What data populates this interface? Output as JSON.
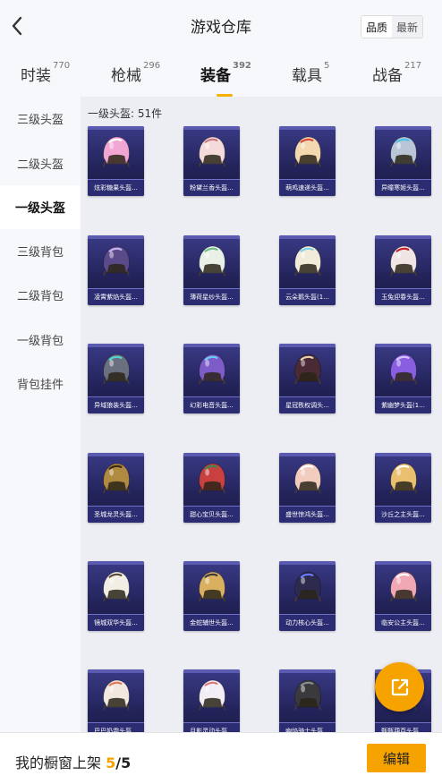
{
  "header": {
    "title": "游戏仓库",
    "sort_options": [
      "品质",
      "最新"
    ],
    "sort_selected": "品质"
  },
  "tabs": [
    {
      "label": "时装",
      "count": "770"
    },
    {
      "label": "枪械",
      "count": "296"
    },
    {
      "label": "装备",
      "count": "392"
    },
    {
      "label": "载具",
      "count": "5"
    },
    {
      "label": "战备",
      "count": "217"
    }
  ],
  "active_tab": "装备",
  "sidebar": {
    "items": [
      {
        "label": "三级头盔"
      },
      {
        "label": "二级头盔"
      },
      {
        "label": "一级头盔"
      },
      {
        "label": "三级背包"
      },
      {
        "label": "二级背包"
      },
      {
        "label": "一级背包"
      },
      {
        "label": "背包挂件"
      }
    ],
    "active": "一级头盔"
  },
  "main": {
    "count_label": "一级头盔: 51件",
    "items": [
      {
        "name": "炫彩糖果头盔...",
        "color": "#f2a6d4",
        "accent": "#ffffff"
      },
      {
        "name": "粉黛兰香头盔...",
        "color": "#f4dada",
        "accent": "#c97a84"
      },
      {
        "name": "萌鸡速递头盔...",
        "color": "#f3d8b0",
        "accent": "#d84a3a"
      },
      {
        "name": "异瞳寒姬头盔...",
        "color": "#b8c6d8",
        "accent": "#4ac3e8"
      },
      {
        "name": "凌霄紫焰头盔...",
        "color": "#5b4a8a",
        "accent": "#c6b2f0"
      },
      {
        "name": "薄荷星纱头盔...",
        "color": "#e8f0e8",
        "accent": "#6fbf8a"
      },
      {
        "name": "云朵鹅头盔(1...",
        "color": "#f1ecd9",
        "accent": "#7fd0e6"
      },
      {
        "name": "玉兔迎春头盔...",
        "color": "#f1e4e4",
        "accent": "#c8202a"
      },
      {
        "name": "异域狼装头盔...",
        "color": "#6b7080",
        "accent": "#4fd6d0"
      },
      {
        "name": "幻彩电音头盔...",
        "color": "#7e5cc8",
        "accent": "#63d2f0"
      },
      {
        "name": "星冠秩权调头...",
        "color": "#4a2a34",
        "accent": "#e8d2b4"
      },
      {
        "name": "紫幽梦头盔(1...",
        "color": "#8a5ee0",
        "accent": "#d6c6ff"
      },
      {
        "name": "圣城龙灵头盔...",
        "color": "#b08a40",
        "accent": "#3a2a10"
      },
      {
        "name": "甜心宝贝头盔...",
        "color": "#c84040",
        "accent": "#3a8a4a"
      },
      {
        "name": "盛世惊鸿头盔...",
        "color": "#f2cdbf",
        "accent": "#ffffff"
      },
      {
        "name": "沙丘之主头盔...",
        "color": "#e8c070",
        "accent": "#ffffff"
      },
      {
        "name": "镜城双华头盔...",
        "color": "#f2eee6",
        "accent": "#5a4a3a"
      },
      {
        "name": "金蛇辅世头盔...",
        "color": "#d8b060",
        "accent": "#3a3a3a"
      },
      {
        "name": "动力核心头盔...",
        "color": "#2e2a4e",
        "accent": "#6a7aff"
      },
      {
        "name": "临安公主头盔...",
        "color": "#f0a8b4",
        "accent": "#ffffff"
      },
      {
        "name": "巴巴奶霜头盔...",
        "color": "#f2e8e0",
        "accent": "#e07a5a"
      },
      {
        "name": "月影灵动头盔...",
        "color": "#f2eef4",
        "accent": "#e07a7a"
      },
      {
        "name": "幽焰骑士头盔...",
        "color": "#3a3a3e",
        "accent": "#8a8a8e"
      },
      {
        "name": "甄甄葫芦头盔...",
        "color": "#e0e6ec",
        "accent": "#a8c4dc"
      }
    ]
  },
  "footer": {
    "label": "我的橱窗上架",
    "current": "5",
    "total": "/5",
    "edit_label": "编辑"
  },
  "colors": {
    "accent": "#f6a300",
    "card_bg": "#2c2c72"
  },
  "icons": {
    "back": "chevron-left-icon",
    "share": "external-link-icon"
  }
}
